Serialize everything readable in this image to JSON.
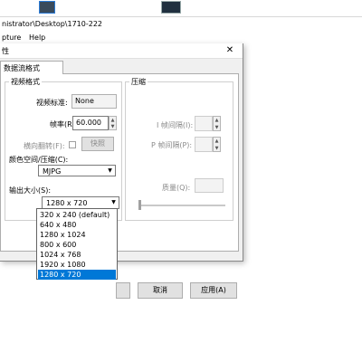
{
  "app": {
    "title_fragment": "nistrator\\Desktop\\1710-222",
    "menu": [
      "pture",
      "Help"
    ]
  },
  "dialog": {
    "title": "性",
    "close_glyph": "✕",
    "tab_label": "数据流格式",
    "video_format": {
      "group_label": "视频格式",
      "standard_label": "视频标准:",
      "standard_value": "None",
      "framerate_label": "帧率(R):",
      "framerate_value": "60.000",
      "flip_label": "横向翻转(F):",
      "flip_button": "快照",
      "colorspace_label": "颜色空间/压缩(C):",
      "colorspace_value": "MJPG",
      "output_size_label": "输出大小(S):",
      "output_size_value": "1280 x 720"
    },
    "compression": {
      "group_label": "压缩",
      "iframe_label": "I 帧间隔(I):",
      "pframe_label": "P 帧间隔(P):",
      "quality_label": "质量(Q):"
    },
    "buttons": {
      "cancel": "取消",
      "apply": "应用(A)"
    }
  },
  "dropdown": {
    "options": [
      "320 x 240  (default)",
      "640 x 480",
      "1280 x 1024",
      "800 x 600",
      "1024 x 768",
      "1920 x 1080",
      "1280 x 720"
    ],
    "selected_index": 6
  },
  "colors": {
    "selection": "#0078d7",
    "dialog_bg": "#f0f0f0"
  }
}
